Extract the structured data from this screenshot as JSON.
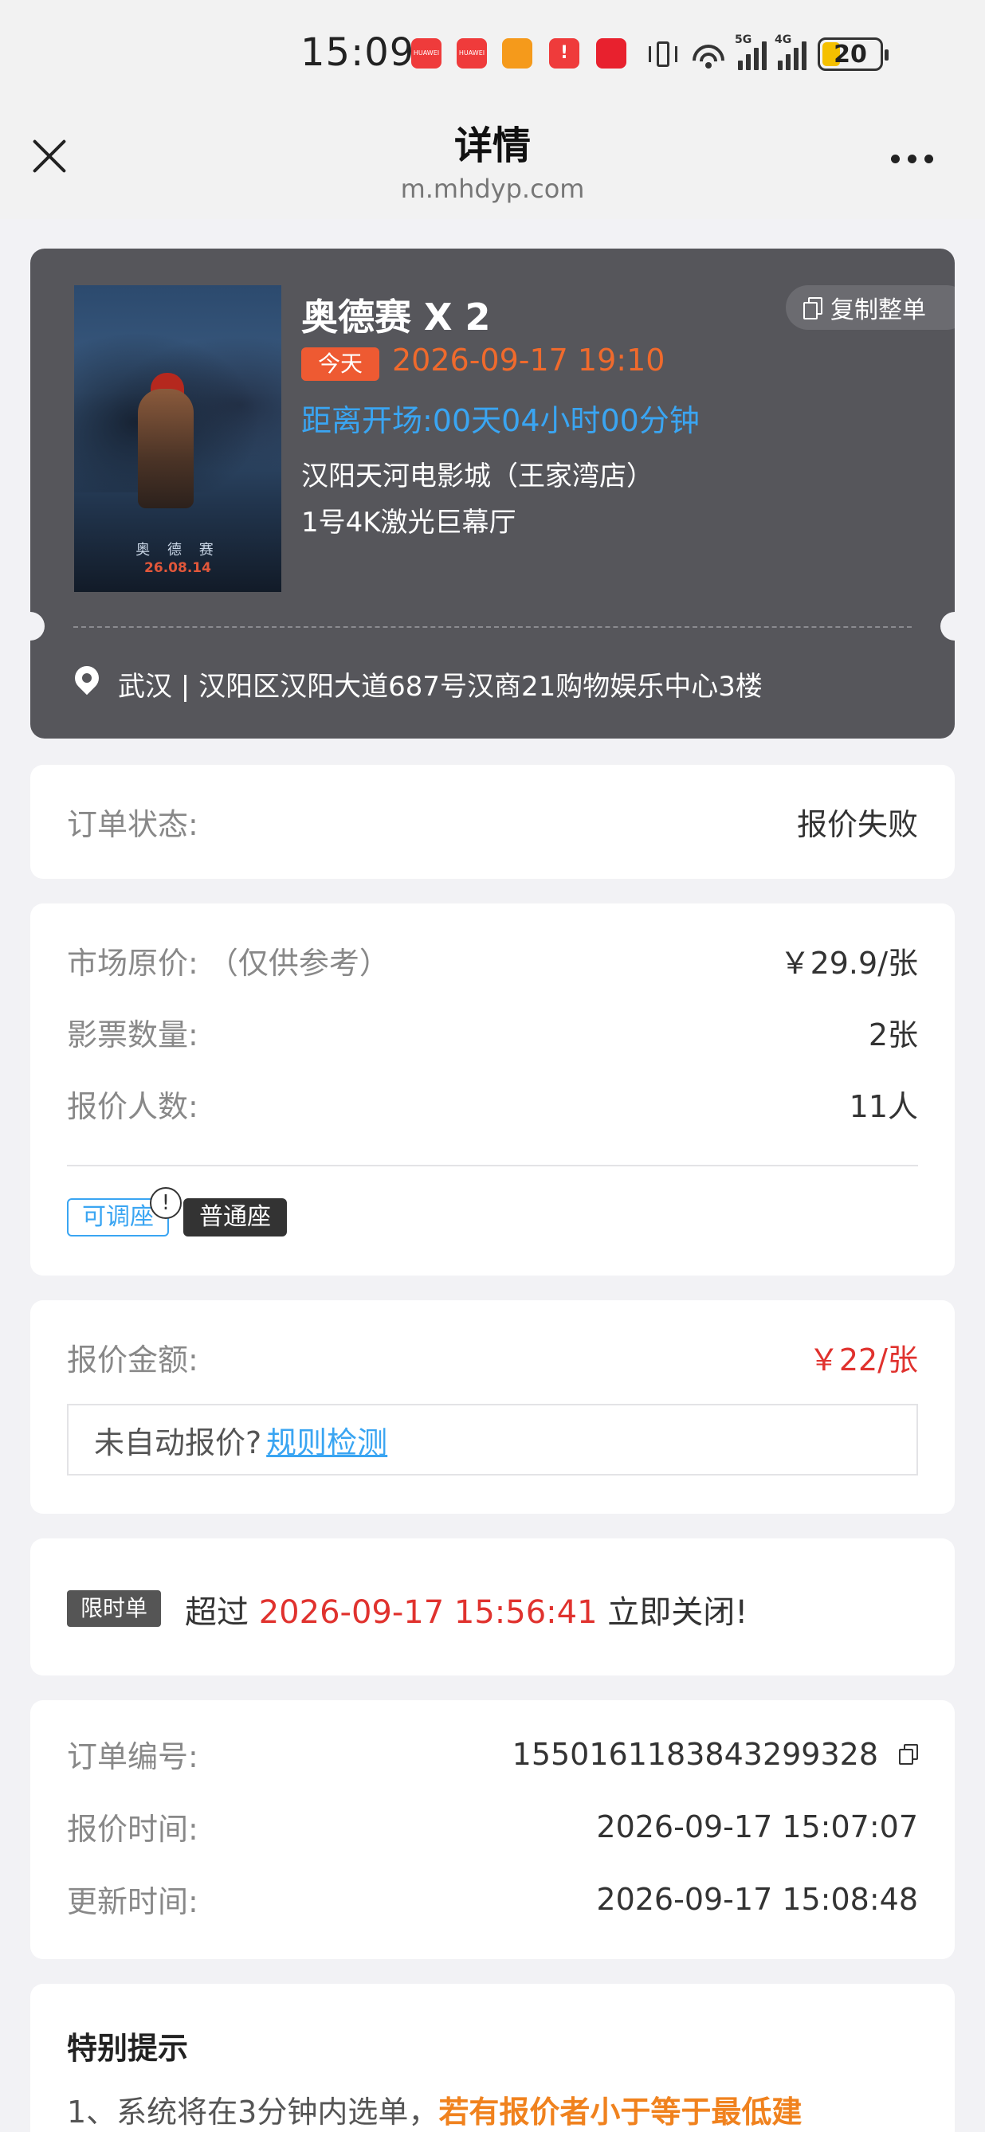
{
  "status_bar": {
    "time": "15:09",
    "apps": [
      {
        "name": "HUAWEI",
        "color": "#ef3b3b"
      },
      {
        "name": "HUAWEI",
        "color": "#ef3b3b"
      },
      {
        "name": "",
        "color": "#f59a1b"
      },
      {
        "name": "!",
        "color": "#ef3b3b"
      },
      {
        "name": "",
        "color": "#e8212e"
      }
    ],
    "network_5g": "5G",
    "network_4g": "4G",
    "battery": "20"
  },
  "nav": {
    "title": "详情",
    "domain": "m.mhdyp.com"
  },
  "ticket": {
    "movie_title": "奥德赛  X 2",
    "copy_label": "复制整单",
    "today_tag": "今天",
    "show_time": "2026-09-17 19:10",
    "countdown": "距离开场:00天04小时00分钟",
    "cinema": "汉阳天河电影城（王家湾店）",
    "hall": "1号4K激光巨幕厅",
    "address": "武汉 | 汉阳区汉阳大道687号汉商21购物娱乐中心3楼",
    "poster": {
      "title": "奥 德 赛",
      "date": "26.08.14"
    }
  },
  "order_status": {
    "label": "订单状态:",
    "value": "报价失败"
  },
  "pricing": {
    "rows": [
      {
        "label": "市场原价: （仅供参考）",
        "value": "￥29.9/张"
      },
      {
        "label": "影票数量:",
        "value": "2张"
      },
      {
        "label": "报价人数:",
        "value": "11人"
      }
    ],
    "tag_adjustable": "可调座",
    "tag_normal": "普通座",
    "info_icon": "!"
  },
  "quote": {
    "label": "报价金额:",
    "value": "￥22/张",
    "no_auto": "未自动报价?",
    "rule_link": "规则检测"
  },
  "limit": {
    "tag": "限时单",
    "prefix": "超过",
    "deadline": "2026-09-17 15:56:41",
    "suffix": "立即关闭!"
  },
  "order_info": {
    "rows": [
      {
        "label": "订单编号:",
        "value": "1550161183843299328"
      },
      {
        "label": "报价时间:",
        "value": "2026-09-17 15:07:07"
      },
      {
        "label": "更新时间:",
        "value": "2026-09-17 15:08:48"
      }
    ]
  },
  "tips": {
    "title": "特别提示",
    "line1_normal": "1、系统将在3分钟内选单，",
    "line1_warn": "若有报价者小于等于最低建"
  },
  "colors": {
    "accent_blue": "#3aa5f2",
    "accent_orange": "#f06a2c",
    "price_red": "#e0322e",
    "ticket_bg": "#56565b"
  }
}
